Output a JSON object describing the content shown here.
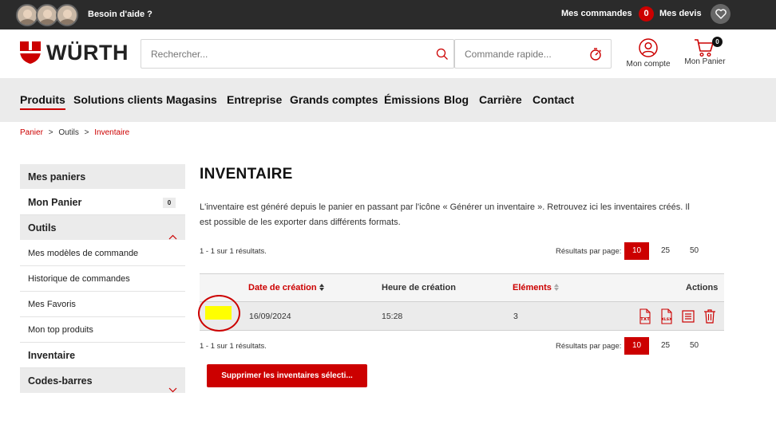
{
  "topbar": {
    "help_text": "Besoin d'aide ?",
    "orders_label": "Mes commandes",
    "quotes_count": "0",
    "quotes_label": "Mes devis",
    "icons": [
      "avatar",
      "avatar",
      "avatar",
      "heart-icon"
    ]
  },
  "header": {
    "logo_text": "WÜRTH",
    "search_placeholder": "Rechercher...",
    "quick_order_placeholder": "Commande rapide...",
    "account_label": "Mon compte",
    "cart_label": "Mon Panier",
    "cart_count": "0"
  },
  "nav": {
    "items": [
      {
        "label": "Produits"
      },
      {
        "label": "Solutions clients"
      },
      {
        "label": "Magasins"
      },
      {
        "label": "Entreprise"
      },
      {
        "label": "Grands comptes"
      },
      {
        "label": "Émissions"
      },
      {
        "label": "Blog"
      },
      {
        "label": "Carrière"
      },
      {
        "label": "Contact"
      }
    ]
  },
  "breadcrumb": {
    "items": [
      "Panier",
      "Outils",
      "Inventaire"
    ],
    "sep": ">"
  },
  "sidebar": {
    "items": [
      {
        "label": "Mes paniers"
      },
      {
        "label": "Mon Panier",
        "count": "0"
      },
      {
        "label": "Outils"
      },
      {
        "label": "Mes modèles de commande"
      },
      {
        "label": "Historique de commandes"
      },
      {
        "label": "Mes Favoris"
      },
      {
        "label": "Mon top produits"
      },
      {
        "label": "Inventaire"
      },
      {
        "label": "Codes-barres"
      }
    ]
  },
  "main": {
    "title": "INVENTAIRE",
    "description": "L'inventaire est généré depuis le panier en passant par l'icône « Générer un inventaire ». Retrouvez ici les inventaires créés. Il est possible de les exporter dans différents formats.",
    "results_count": "1 - 1 sur 1 résultats.",
    "per_page_label": "Résultats par page:",
    "per_page_options": [
      "10",
      "25",
      "50"
    ],
    "per_page_selected": "10",
    "table": {
      "headers": [
        "Date de création",
        "Heure de création",
        "Eléments",
        "Actions"
      ],
      "rows": [
        {
          "date": "16/09/2024",
          "time": "15:28",
          "elements": "3",
          "actions": [
            "txt-export-icon",
            "xlsx-export-icon",
            "list-icon",
            "trash-icon"
          ]
        }
      ]
    },
    "delete_button": "Supprimer les inventaires sélecti..."
  },
  "colors": {
    "brand": "#cc0000",
    "topbar": "#2b2b2b",
    "nav_bg": "#ebebeb",
    "highlight": "#ffff00"
  }
}
